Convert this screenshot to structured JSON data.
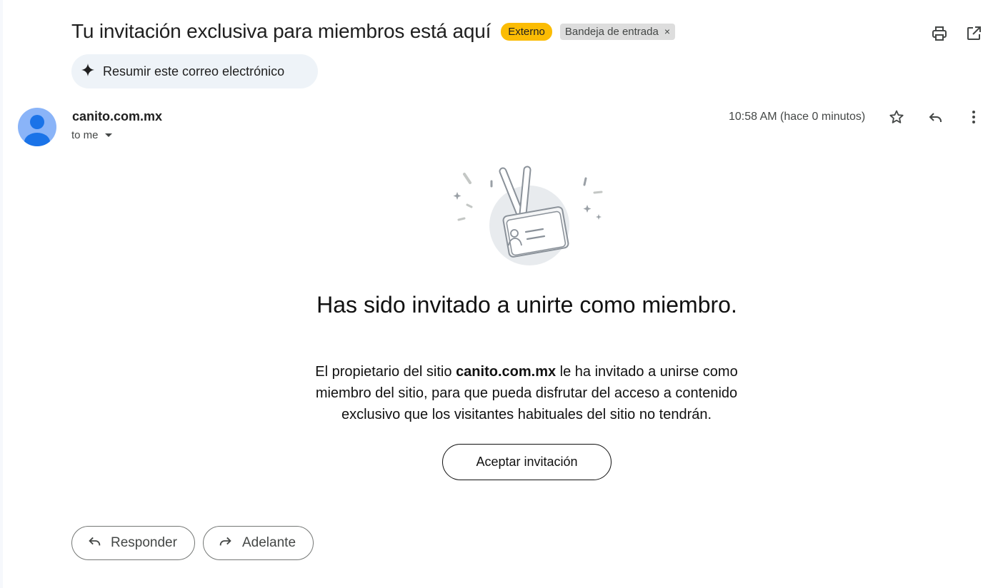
{
  "subject": "Tu invitación exclusiva para miembros está aquí",
  "labels": {
    "external": "Externo",
    "inbox": "Bandeja de entrada",
    "inbox_remove": "×"
  },
  "summarize_label": "Resumir este correo electrónico",
  "message": {
    "sender": "canito.com.mx",
    "recipient": "to me",
    "timestamp": "10:58 AM (hace 0 minutos)"
  },
  "email_body": {
    "headline": "Has sido invitado a unirte como miembro.",
    "paragraph_prefix": "El propietario del sitio ",
    "site_name": "canito.com.mx",
    "paragraph_suffix": " le ha invitado a unirse como miembro del sitio, para que pueda disfrutar del acceso a contenido exclusivo que los visitantes habituales del sitio no tendrán.",
    "cta_label": "Aceptar invitación"
  },
  "actions": {
    "reply": "Responder",
    "forward": "Adelante"
  },
  "icons": [
    "print-icon",
    "open-in-new-window-icon",
    "sparkle-icon",
    "star-icon",
    "reply-icon",
    "more-vert-icon",
    "forward-icon",
    "dropdown-arrow-icon"
  ],
  "colors": {
    "external_badge": "#fbbc04",
    "avatar": "#8ab4f8",
    "avatar_figure": "#1a73e8",
    "summarize_bg": "#eef3f8"
  }
}
